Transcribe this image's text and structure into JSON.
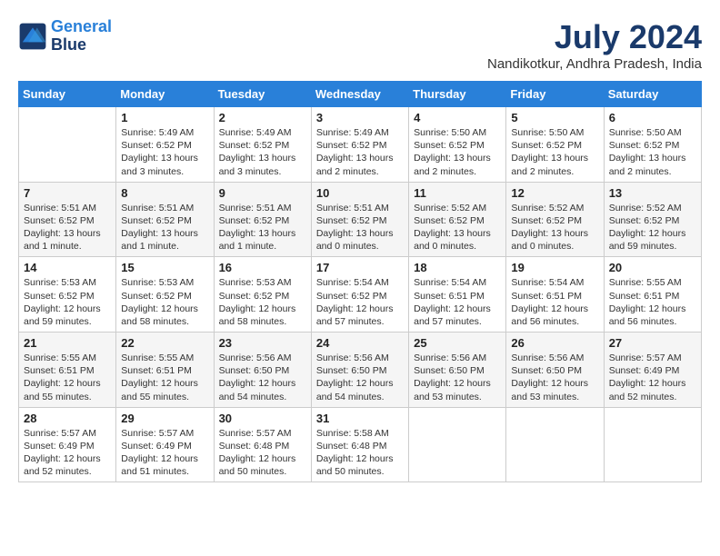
{
  "header": {
    "logo_line1": "General",
    "logo_line2": "Blue",
    "month_title": "July 2024",
    "location": "Nandikotkur, Andhra Pradesh, India"
  },
  "weekdays": [
    "Sunday",
    "Monday",
    "Tuesday",
    "Wednesday",
    "Thursday",
    "Friday",
    "Saturday"
  ],
  "weeks": [
    [
      {
        "day": "",
        "info": ""
      },
      {
        "day": "1",
        "info": "Sunrise: 5:49 AM\nSunset: 6:52 PM\nDaylight: 13 hours\nand 3 minutes."
      },
      {
        "day": "2",
        "info": "Sunrise: 5:49 AM\nSunset: 6:52 PM\nDaylight: 13 hours\nand 3 minutes."
      },
      {
        "day": "3",
        "info": "Sunrise: 5:49 AM\nSunset: 6:52 PM\nDaylight: 13 hours\nand 2 minutes."
      },
      {
        "day": "4",
        "info": "Sunrise: 5:50 AM\nSunset: 6:52 PM\nDaylight: 13 hours\nand 2 minutes."
      },
      {
        "day": "5",
        "info": "Sunrise: 5:50 AM\nSunset: 6:52 PM\nDaylight: 13 hours\nand 2 minutes."
      },
      {
        "day": "6",
        "info": "Sunrise: 5:50 AM\nSunset: 6:52 PM\nDaylight: 13 hours\nand 2 minutes."
      }
    ],
    [
      {
        "day": "7",
        "info": "Sunrise: 5:51 AM\nSunset: 6:52 PM\nDaylight: 13 hours\nand 1 minute."
      },
      {
        "day": "8",
        "info": "Sunrise: 5:51 AM\nSunset: 6:52 PM\nDaylight: 13 hours\nand 1 minute."
      },
      {
        "day": "9",
        "info": "Sunrise: 5:51 AM\nSunset: 6:52 PM\nDaylight: 13 hours\nand 1 minute."
      },
      {
        "day": "10",
        "info": "Sunrise: 5:51 AM\nSunset: 6:52 PM\nDaylight: 13 hours\nand 0 minutes."
      },
      {
        "day": "11",
        "info": "Sunrise: 5:52 AM\nSunset: 6:52 PM\nDaylight: 13 hours\nand 0 minutes."
      },
      {
        "day": "12",
        "info": "Sunrise: 5:52 AM\nSunset: 6:52 PM\nDaylight: 13 hours\nand 0 minutes."
      },
      {
        "day": "13",
        "info": "Sunrise: 5:52 AM\nSunset: 6:52 PM\nDaylight: 12 hours\nand 59 minutes."
      }
    ],
    [
      {
        "day": "14",
        "info": "Sunrise: 5:53 AM\nSunset: 6:52 PM\nDaylight: 12 hours\nand 59 minutes."
      },
      {
        "day": "15",
        "info": "Sunrise: 5:53 AM\nSunset: 6:52 PM\nDaylight: 12 hours\nand 58 minutes."
      },
      {
        "day": "16",
        "info": "Sunrise: 5:53 AM\nSunset: 6:52 PM\nDaylight: 12 hours\nand 58 minutes."
      },
      {
        "day": "17",
        "info": "Sunrise: 5:54 AM\nSunset: 6:52 PM\nDaylight: 12 hours\nand 57 minutes."
      },
      {
        "day": "18",
        "info": "Sunrise: 5:54 AM\nSunset: 6:51 PM\nDaylight: 12 hours\nand 57 minutes."
      },
      {
        "day": "19",
        "info": "Sunrise: 5:54 AM\nSunset: 6:51 PM\nDaylight: 12 hours\nand 56 minutes."
      },
      {
        "day": "20",
        "info": "Sunrise: 5:55 AM\nSunset: 6:51 PM\nDaylight: 12 hours\nand 56 minutes."
      }
    ],
    [
      {
        "day": "21",
        "info": "Sunrise: 5:55 AM\nSunset: 6:51 PM\nDaylight: 12 hours\nand 55 minutes."
      },
      {
        "day": "22",
        "info": "Sunrise: 5:55 AM\nSunset: 6:51 PM\nDaylight: 12 hours\nand 55 minutes."
      },
      {
        "day": "23",
        "info": "Sunrise: 5:56 AM\nSunset: 6:50 PM\nDaylight: 12 hours\nand 54 minutes."
      },
      {
        "day": "24",
        "info": "Sunrise: 5:56 AM\nSunset: 6:50 PM\nDaylight: 12 hours\nand 54 minutes."
      },
      {
        "day": "25",
        "info": "Sunrise: 5:56 AM\nSunset: 6:50 PM\nDaylight: 12 hours\nand 53 minutes."
      },
      {
        "day": "26",
        "info": "Sunrise: 5:56 AM\nSunset: 6:50 PM\nDaylight: 12 hours\nand 53 minutes."
      },
      {
        "day": "27",
        "info": "Sunrise: 5:57 AM\nSunset: 6:49 PM\nDaylight: 12 hours\nand 52 minutes."
      }
    ],
    [
      {
        "day": "28",
        "info": "Sunrise: 5:57 AM\nSunset: 6:49 PM\nDaylight: 12 hours\nand 52 minutes."
      },
      {
        "day": "29",
        "info": "Sunrise: 5:57 AM\nSunset: 6:49 PM\nDaylight: 12 hours\nand 51 minutes."
      },
      {
        "day": "30",
        "info": "Sunrise: 5:57 AM\nSunset: 6:48 PM\nDaylight: 12 hours\nand 50 minutes."
      },
      {
        "day": "31",
        "info": "Sunrise: 5:58 AM\nSunset: 6:48 PM\nDaylight: 12 hours\nand 50 minutes."
      },
      {
        "day": "",
        "info": ""
      },
      {
        "day": "",
        "info": ""
      },
      {
        "day": "",
        "info": ""
      }
    ]
  ]
}
